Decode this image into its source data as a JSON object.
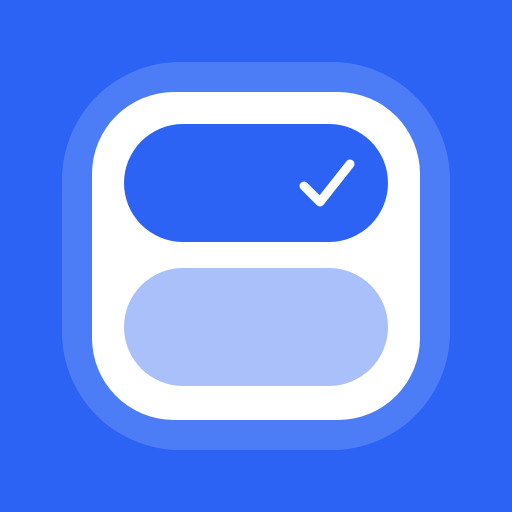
{
  "icon": {
    "name": "toggle-checklist-app-icon",
    "colors": {
      "background": "#2c63f5",
      "halo": "#4d7cf7",
      "card": "#ffffff",
      "selected_option": "#2c63f5",
      "unselected_option": "#a9c0fb",
      "check": "#ffffff"
    },
    "options": [
      {
        "state": "selected",
        "icon": "checkmark-icon"
      },
      {
        "state": "unselected",
        "icon": ""
      }
    ]
  }
}
